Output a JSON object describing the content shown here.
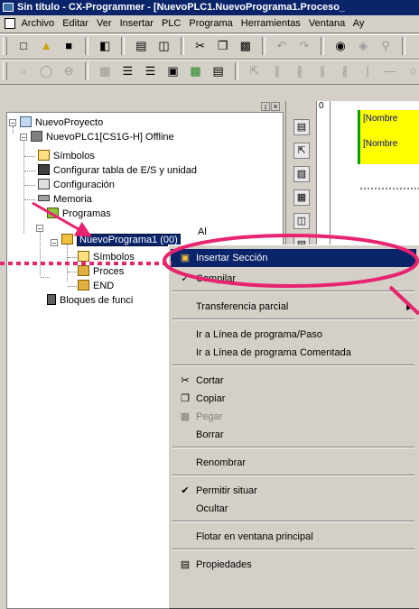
{
  "window": {
    "title": "Sin título - CX-Programmer - [NuevoPLC1.NuevoPrograma1.Proceso_"
  },
  "menubar": {
    "items": [
      "Archivo",
      "Editar",
      "Ver",
      "Insertar",
      "PLC",
      "Programa",
      "Herramientas",
      "Ventana",
      "Ay"
    ]
  },
  "tree": {
    "project": "NuevoProyecto",
    "plc": "NuevoPLC1[CS1G-H] Offline",
    "simbolos": "Símbolos",
    "config_tabla": "Configurar tabla de E/S y unidad",
    "configuracion": "Configuración",
    "memoria": "Memoria",
    "programas": "Programas",
    "programa1": "NuevoPrograma1 (00)",
    "prog_simbolos": "Símbolos",
    "prog_proceso": "Proces",
    "prog_end": "END",
    "bloques": "Bloques de funci"
  },
  "diagram": {
    "row_number": "0",
    "label1": "[Nombre",
    "label2": "[Nombre"
  },
  "context_menu": {
    "partial_top": "Al",
    "insertar_seccion": "Insertar Sección",
    "compilar": "Compilar",
    "transferencia_parcial": "Transferencia parcial",
    "ir_linea": "Ir a Línea de programa/Paso",
    "ir_linea_comentada": "Ir a Línea de programa Comentada",
    "cortar": "Cortar",
    "copiar": "Copiar",
    "pegar": "Pegar",
    "borrar": "Borrar",
    "renombrar": "Renombrar",
    "permitir_situar": "Permitir situar",
    "ocultar": "Ocultar",
    "flotar": "Flotar en ventana principal",
    "propiedades": "Propiedades"
  },
  "colors": {
    "titlebar": "#0a246a",
    "highlight": "#0a246a",
    "annotation": "#e8236f",
    "rung": "#ffff00"
  }
}
